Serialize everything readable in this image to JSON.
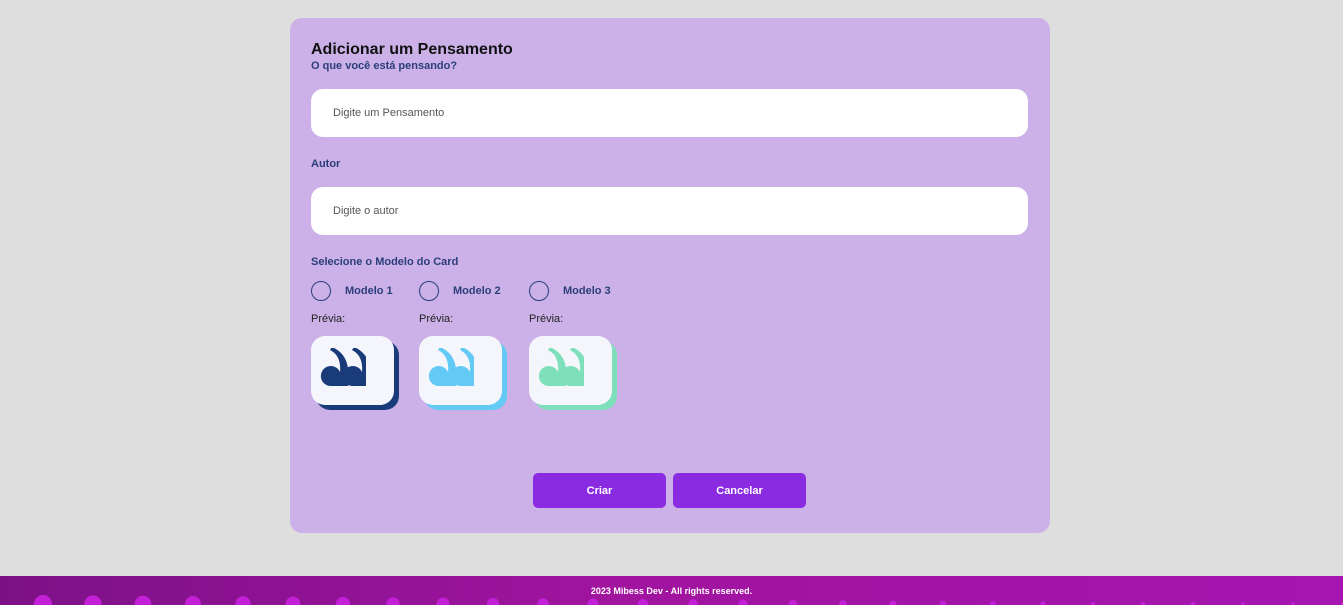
{
  "modal": {
    "title": "Adicionar um Pensamento",
    "subtitle": "O que você está pensando?",
    "thought_placeholder": "Digite um Pensamento",
    "author_label": "Autor",
    "author_placeholder": "Digite o autor",
    "model_label": "Selecione o Modelo do Card",
    "models": [
      {
        "label": "Modelo 1",
        "preview_label": "Prévia:",
        "color": "#1a3b7a"
      },
      {
        "label": "Modelo 2",
        "preview_label": "Prévia:",
        "color": "#63c9f5"
      },
      {
        "label": "Modelo 3",
        "preview_label": "Prévia:",
        "color": "#7ee0bb"
      }
    ],
    "create_label": "Criar",
    "cancel_label": "Cancelar"
  },
  "footer": {
    "text": "2023 Mibess Dev - All rights reserved."
  },
  "colors": {
    "modal_bg": "#cbb1e8",
    "accent": "#8a2be2",
    "text_blue": "#2c3e7a"
  }
}
